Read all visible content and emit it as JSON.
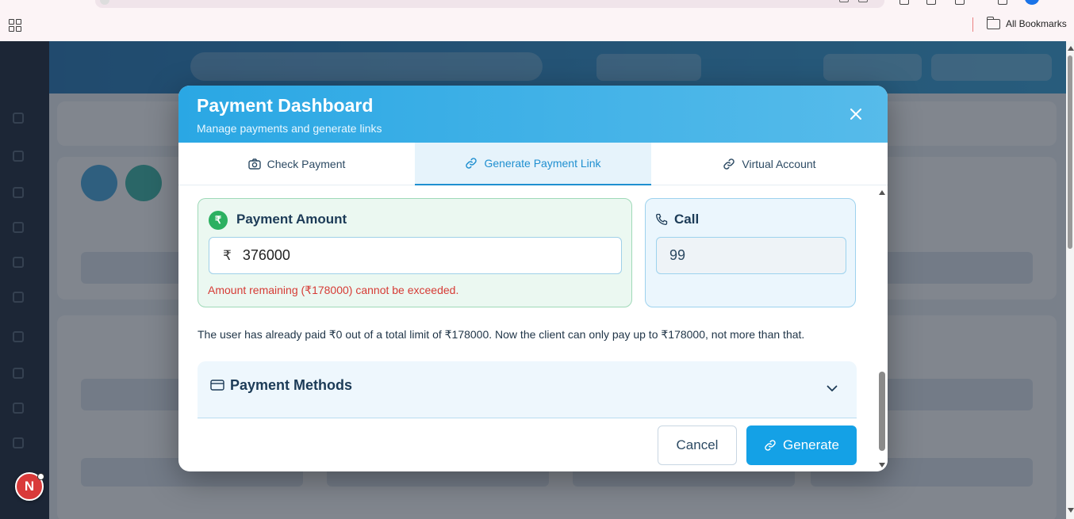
{
  "browser": {
    "bookmarks_label": "All Bookmarks"
  },
  "notification": {
    "avatar_letter": "N"
  },
  "modal": {
    "title": "Payment Dashboard",
    "subtitle": "Manage payments and generate links",
    "tabs": [
      {
        "label": "Check Payment",
        "icon": "camera-icon",
        "active": false
      },
      {
        "label": "Generate Payment Link",
        "icon": "link-icon",
        "active": true
      },
      {
        "label": "Virtual Account",
        "icon": "link-icon",
        "active": false
      }
    ],
    "amount": {
      "label": "Payment Amount",
      "badge": "₹",
      "currency_symbol": "₹",
      "value": "376000",
      "error": "Amount remaining (₹178000) cannot be exceeded."
    },
    "call": {
      "label": "Call",
      "value": "99"
    },
    "info": "The user has already paid ₹0 out of a total limit of ₹178000. Now the client can only pay up to ₹178000, not more than that.",
    "payment_methods": {
      "label": "Payment Methods"
    },
    "buttons": {
      "cancel": "Cancel",
      "generate": "Generate"
    }
  },
  "colors": {
    "header_gradient_start": "#2aa7e4",
    "header_gradient_end": "#56bbea",
    "accent": "#14a1e6",
    "success": "#2cb061",
    "error": "#d63b35"
  }
}
